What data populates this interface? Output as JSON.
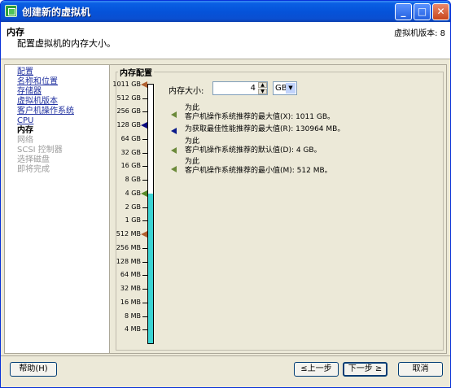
{
  "window": {
    "title": "创建新的虚拟机",
    "minimize": "_",
    "maximize": "□",
    "close": "✕"
  },
  "header": {
    "title": "内存",
    "subtitle": "配置虚拟机的内存大小。",
    "version": "虚拟机版本: 8"
  },
  "sidebar": {
    "items": [
      {
        "label": "配置",
        "state": "done"
      },
      {
        "label": "名称和位置",
        "state": "done"
      },
      {
        "label": "存储器",
        "state": "done"
      },
      {
        "label": "虚拟机版本",
        "state": "done"
      },
      {
        "label": "客户机操作系统",
        "state": "done"
      },
      {
        "label": "CPU",
        "state": "done"
      },
      {
        "label": "内存",
        "state": "current"
      },
      {
        "label": "网络",
        "state": "future"
      },
      {
        "label": "SCSI 控制器",
        "state": "future"
      },
      {
        "label": "选择磁盘",
        "state": "future"
      },
      {
        "label": "即将完成",
        "state": "future"
      }
    ]
  },
  "memory": {
    "group_title": "内存配置",
    "size_label": "内存大小:",
    "size_value": "4",
    "unit": "GB",
    "scale_labels": [
      "1011 GB",
      "512 GB",
      "256 GB",
      "128 GB",
      "64 GB",
      "32 GB",
      "16 GB",
      "8 GB",
      "4 GB",
      "2 GB",
      "1 GB",
      "512 MB",
      "256 MB",
      "128 MB",
      "64 MB",
      "32 MB",
      "16 MB",
      "8 MB",
      "4 MB"
    ],
    "notes": [
      {
        "line1": "为此",
        "line2": "客户机操作系统推荐的最大值(X): 1011 GB。"
      },
      {
        "line1": "为获取最佳性能推荐的最大值(R): 130964 MB。",
        "line2": ""
      },
      {
        "line1": "为此",
        "line2": "客户机操作系统推荐的默认值(D): 4 GB。"
      },
      {
        "line1": "为此",
        "line2": "客户机操作系统推荐的最小值(M): 512 MB。"
      }
    ]
  },
  "buttons": {
    "help": "帮助(H)",
    "back": "≤上一步",
    "next": "下一步 ≥",
    "cancel": "取消"
  },
  "colors": {
    "titlebar": "#0553da",
    "slider_fill": "#3bd4d4",
    "link": "#1f2f9f"
  }
}
